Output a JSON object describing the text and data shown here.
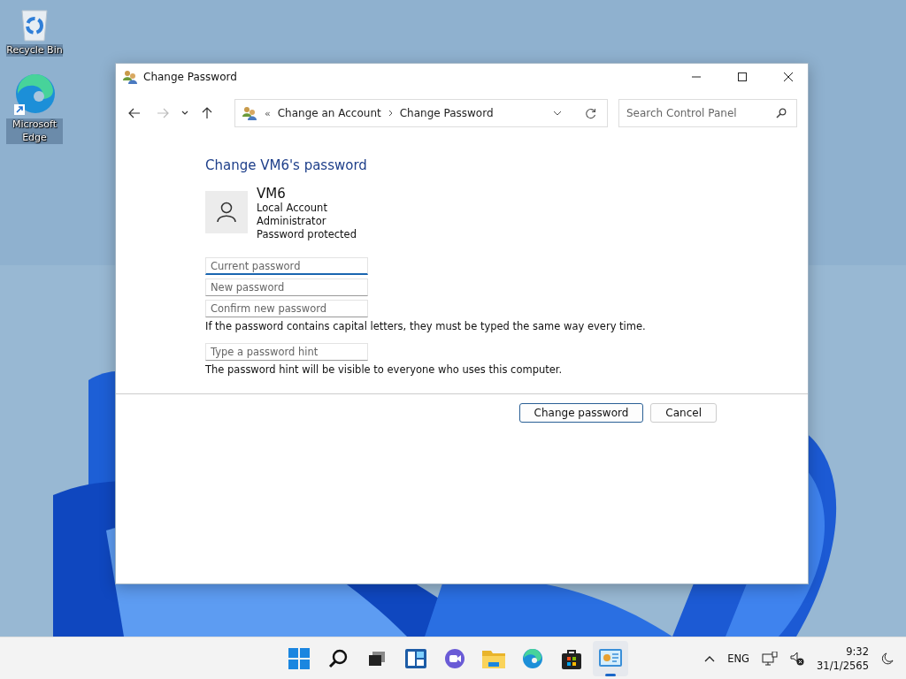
{
  "desktop_icons": [
    {
      "kind": "recycle",
      "label": "Recycle Bin"
    },
    {
      "kind": "edge",
      "label": "Microsoft Edge"
    }
  ],
  "window": {
    "title": "Change Password"
  },
  "nav": [
    {
      "kind": "back",
      "disabled": false
    },
    {
      "kind": "forward",
      "disabled": true
    },
    {
      "kind": "recent",
      "disabled": false
    },
    {
      "kind": "up",
      "disabled": false
    }
  ],
  "address": {
    "overflow": "«",
    "crumbs": [
      "Change an Account",
      "Change Password"
    ]
  },
  "search": {
    "placeholder": "Search Control Panel"
  },
  "heading": "Change VM6's password",
  "account": {
    "name": "VM6",
    "lines": [
      "Local Account",
      "Administrator",
      "Password protected"
    ]
  },
  "fields": [
    {
      "placeholder": "Current password",
      "focused": true
    },
    {
      "placeholder": "New password",
      "focused": false
    },
    {
      "placeholder": "Confirm new password",
      "focused": false
    }
  ],
  "caps_note": "If the password contains capital letters, they must be typed the same way every time.",
  "hint_field": {
    "placeholder": "Type a password hint",
    "focused": false
  },
  "hint_note": "The password hint will be visible to everyone who uses this computer.",
  "buttons": [
    {
      "label": "Change password",
      "default": true
    },
    {
      "label": "Cancel",
      "default": false
    }
  ],
  "taskbar": {
    "apps": [
      {
        "kind": "start",
        "active": false
      },
      {
        "kind": "search",
        "active": false
      },
      {
        "kind": "taskview",
        "active": false
      },
      {
        "kind": "widgets",
        "active": false
      },
      {
        "kind": "chat",
        "active": false
      },
      {
        "kind": "explorer",
        "active": false
      },
      {
        "kind": "edge",
        "active": false
      },
      {
        "kind": "store",
        "active": false
      },
      {
        "kind": "controlpanel",
        "active": true
      }
    ],
    "tray_language": "ENG",
    "time": "9:32",
    "date": "31/1/2565"
  }
}
